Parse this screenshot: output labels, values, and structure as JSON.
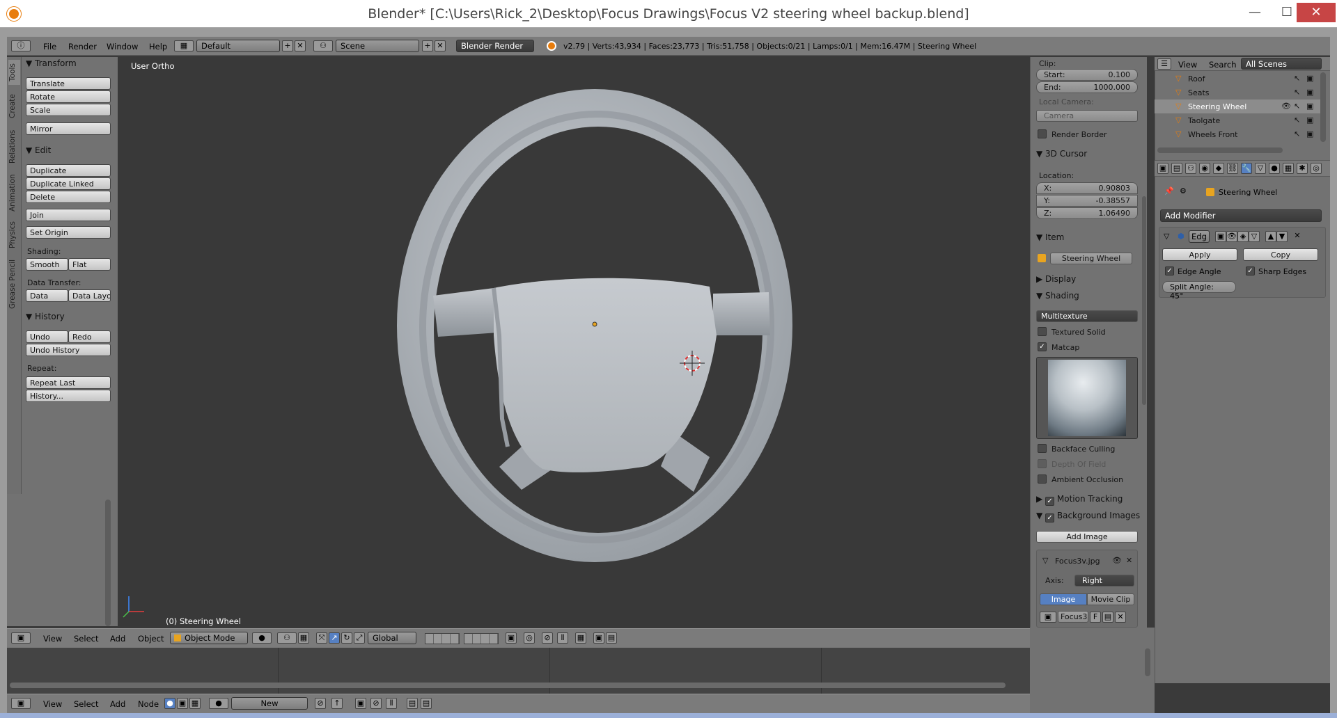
{
  "window": {
    "title": "Blender* [C:\\Users\\Rick_2\\Desktop\\Focus Drawings\\Focus V2 steering wheel backup.blend]",
    "minimize": "—",
    "maximize": "☐",
    "close": "✕"
  },
  "infobar": {
    "menus": [
      "File",
      "Render",
      "Window",
      "Help"
    ],
    "layout": "Default",
    "scene": "Scene",
    "engine": "Blender Render",
    "stats": "v2.79 | Verts:43,934 | Faces:23,773 | Tris:51,758 | Objects:0/21 | Lamps:0/1 | Mem:16.47M | Steering Wheel"
  },
  "left_tabs": [
    "Tools",
    "Create",
    "Relations",
    "Animation",
    "Physics",
    "Grease Pencil"
  ],
  "toolshelf": {
    "transform": {
      "title": "Transform",
      "buttons": [
        "Translate",
        "Rotate",
        "Scale",
        "Mirror"
      ]
    },
    "edit": {
      "title": "Edit",
      "buttons": [
        "Duplicate",
        "Duplicate Linked",
        "Delete",
        "Join"
      ],
      "set_origin": "Set Origin",
      "shading_label": "Shading:",
      "smooth": "Smooth",
      "flat": "Flat",
      "data_transfer_label": "Data Transfer:",
      "data": "Data",
      "data_layout": "Data Layo"
    },
    "history": {
      "title": "History",
      "undo": "Undo",
      "redo": "Redo",
      "undo_history": "Undo History",
      "repeat_label": "Repeat:",
      "repeat_last": "Repeat Last",
      "history": "History..."
    }
  },
  "viewport": {
    "view_label": "User Ortho",
    "object_label": "(0) Steering Wheel"
  },
  "properties": {
    "clip_label": "Clip:",
    "start_label": "Start:",
    "start_value": "0.100",
    "end_label": "End:",
    "end_value": "1000.000",
    "local_camera_label": "Local Camera:",
    "camera_placeholder": "Camera",
    "render_border": "Render Border",
    "cursor_title": "3D Cursor",
    "location_label": "Location:",
    "x_label": "X:",
    "x_value": "0.90803",
    "y_label": "Y:",
    "y_value": "-0.38557",
    "z_label": "Z:",
    "z_value": "1.06490",
    "item_title": "Item",
    "item_name": "Steering Wheel",
    "display_title": "Display",
    "shading_title": "Shading",
    "shading_mode": "Multitexture",
    "textured_solid": "Textured Solid",
    "matcap": "Matcap",
    "backface_culling": "Backface Culling",
    "depth_of_field": "Depth Of Field",
    "ambient_occlusion": "Ambient Occlusion",
    "motion_tracking": "Motion Tracking",
    "background_images": "Background Images",
    "add_image": "Add Image",
    "bg_image_name": "Focus3v.jpg",
    "axis_label": "Axis:",
    "axis_value": "Right",
    "image_tab": "Image",
    "movie_clip_tab": "Movie Clip",
    "image_field": "Focus3",
    "image_field_f": "F"
  },
  "outliner": {
    "view": "View",
    "search": "Search",
    "scene_filter": "All Scenes",
    "items": [
      "Roof",
      "Seats",
      "Steering Wheel",
      "Taolgate",
      "Wheels Front"
    ],
    "selected_index": 2
  },
  "modifier_panel": {
    "object_name": "Steering Wheel",
    "add_modifier": "Add Modifier",
    "modifier_name": "Edg",
    "apply": "Apply",
    "copy": "Copy",
    "edge_angle": "Edge Angle",
    "sharp_edges": "Sharp Edges",
    "split_angle": "Split Angle: 45°"
  },
  "viewport_header": {
    "menus": [
      "View",
      "Select",
      "Add",
      "Object"
    ],
    "mode": "Object Mode",
    "orientation": "Global"
  },
  "node_header": {
    "menus": [
      "View",
      "Select",
      "Add",
      "Node"
    ],
    "new": "New"
  },
  "colors": {
    "accent": "#5680c2",
    "orange": "#e87d0d",
    "panel": "#727272",
    "viewport": "#393939"
  }
}
